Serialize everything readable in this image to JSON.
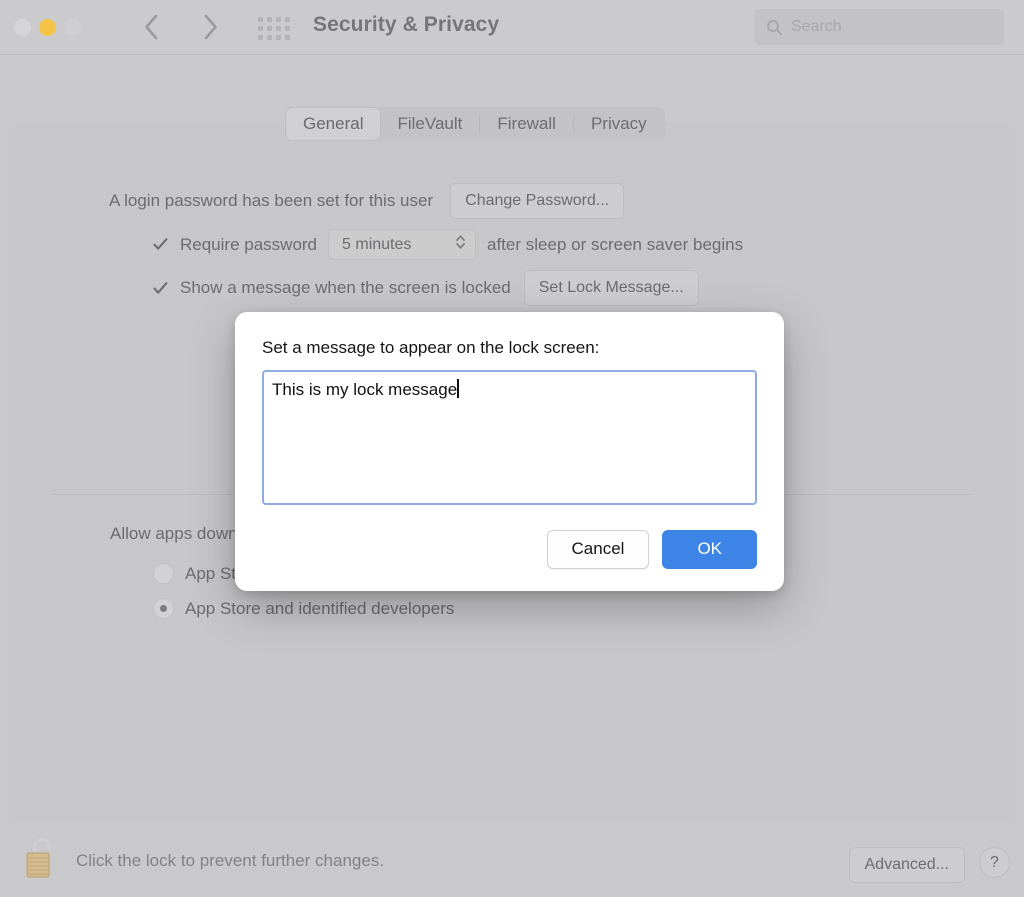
{
  "window": {
    "title": "Security & Privacy",
    "traffic_lights": [
      {
        "name": "close",
        "color": "#d5d5d7"
      },
      {
        "name": "minimize",
        "color": "#f6c445"
      },
      {
        "name": "zoom",
        "color": "#cfcfd1"
      }
    ],
    "nav": {
      "back": "back-arrow",
      "forward": "forward-arrow"
    },
    "show_all_icon": "grid-icon"
  },
  "search": {
    "placeholder": "Search",
    "value": "",
    "icon": "search-icon"
  },
  "tabs": [
    {
      "label": "General",
      "selected": true
    },
    {
      "label": "FileVault",
      "selected": false
    },
    {
      "label": "Firewall",
      "selected": false
    },
    {
      "label": "Privacy",
      "selected": false
    }
  ],
  "general": {
    "password_status": "A login password has been set for this user",
    "change_password_label": "Change Password...",
    "require_password": {
      "checked": true,
      "label": "Require password",
      "delay_value": "5 minutes",
      "suffix": "after sleep or screen saver begins"
    },
    "lock_message": {
      "checked": true,
      "label": "Show a message when the screen is locked",
      "button_label": "Set Lock Message..."
    }
  },
  "gatekeeper": {
    "title": "Allow apps downloaded from:",
    "options": [
      {
        "label": "App Store",
        "selected": false
      },
      {
        "label": "App Store and identified developers",
        "selected": true
      }
    ]
  },
  "bottom": {
    "lock_icon": "unlocked-padlock-icon",
    "lock_text": "Click the lock to prevent further changes.",
    "advanced_label": "Advanced...",
    "help_label": "?"
  },
  "dialog": {
    "title": "Set a message to appear on the lock screen:",
    "textarea_value": "This is my lock message",
    "cancel_label": "Cancel",
    "ok_label": "OK",
    "accent_color": "#3c84e6",
    "focus_border_color": "#8fabe3"
  }
}
